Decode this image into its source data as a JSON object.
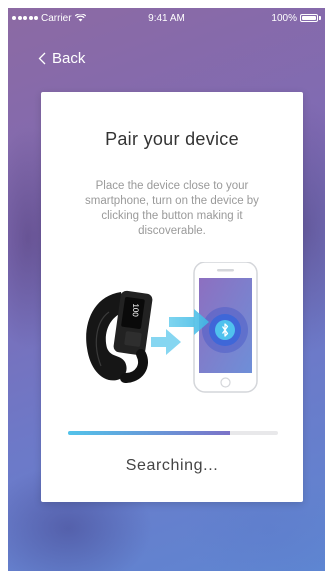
{
  "status_bar": {
    "carrier": "Carrier",
    "time": "9:41 AM",
    "battery": "100%"
  },
  "nav": {
    "back_label": "Back"
  },
  "card": {
    "title": "Pair your device",
    "description": "Place the device close to your smartphone, turn on the device by clicking the button making it discoverable.",
    "band_display": "100",
    "progress": 0.77,
    "status_text": "Searching..."
  },
  "colors": {
    "accent": "#52c3ea",
    "progress_end": "#7b72c8"
  },
  "icons": {
    "back": "chevron-left-icon",
    "bluetooth": "bluetooth-icon",
    "wifi": "wifi-icon",
    "battery": "battery-icon"
  }
}
